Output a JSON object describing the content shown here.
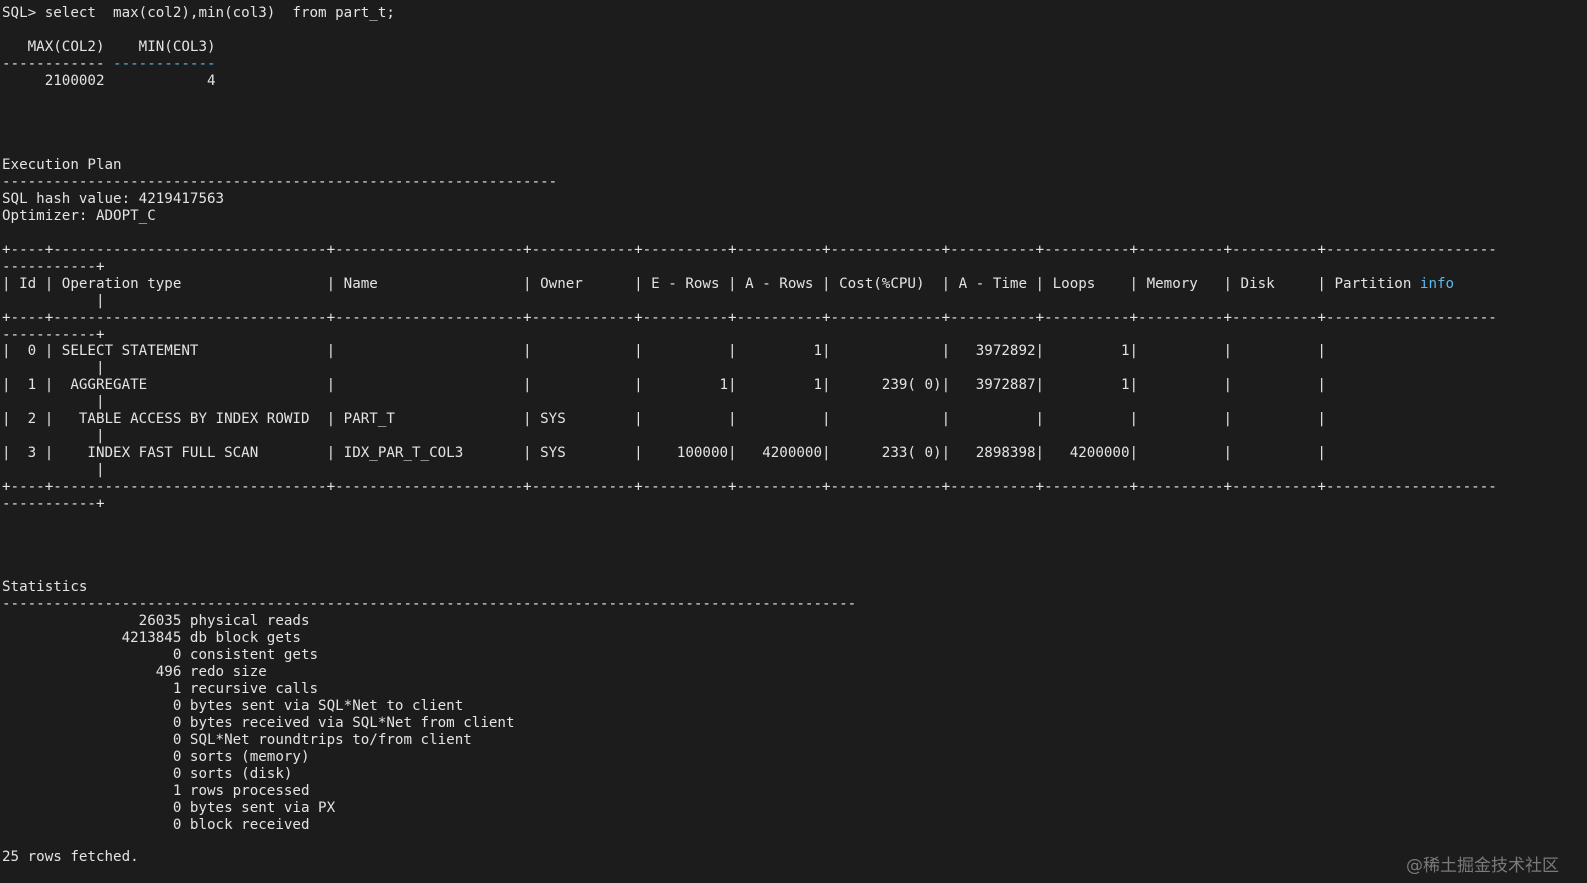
{
  "prompt_line": "SQL> select  max(col2),min(col3)  from part_t;",
  "result": {
    "header_line": "   MAX(COL2)    MIN(COL3)",
    "separator_left": "------------ ",
    "separator_right": "------------",
    "value_line": "     2100002            4"
  },
  "execution_plan": {
    "title": "Execution Plan",
    "rule": "-----------------------------------------------------------------",
    "hash_line": "SQL hash value: 4219417563",
    "optimizer_line": "Optimizer: ADOPT_C",
    "border_top": "+----+--------------------------------+----------------------+------------+----------+----------+-------------+----------+----------+----------+----------+--------------------",
    "border_top_wrap": "-----------+",
    "header_row": "| Id | Operation type                 | Name                 | Owner      | E - Rows | A - Rows | Cost(%CPU)  | A - Time | Loops    | Memory   | Disk     | Partition ",
    "header_highlight": "info",
    "header_wrap": "           |",
    "border_mid": "+----+--------------------------------+----------------------+------------+----------+----------+-------------+----------+----------+----------+----------+--------------------",
    "border_mid_wrap": "-----------+",
    "rows": [
      {
        "line": "|  0 | SELECT STATEMENT               |                      |            |          |         1|             |   3972892|         1|          |          |",
        "wrap": "           |"
      },
      {
        "line": "|  1 |  AGGREGATE                     |                      |            |         1|         1|      239( 0)|   3972887|         1|          |          |",
        "wrap": "           |"
      },
      {
        "line": "|  2 |   TABLE ACCESS BY INDEX ROWID  | PART_T               | SYS        |          |          |             |          |          |          |          |",
        "wrap": "           |"
      },
      {
        "line": "|  3 |    INDEX FAST FULL SCAN        | IDX_PAR_T_COL3       | SYS        |    100000|   4200000|      233( 0)|   2898398|   4200000|          |          |",
        "wrap": "           |"
      }
    ],
    "border_bottom": "+----+--------------------------------+----------------------+------------+----------+----------+-------------+----------+----------+----------+----------+--------------------",
    "border_bottom_wrap": "-----------+"
  },
  "statistics": {
    "title": "Statistics",
    "rule": "----------------------------------------------------------------------------------------------------",
    "items": [
      "                26035 physical reads",
      "              4213845 db block gets",
      "                    0 consistent gets",
      "                  496 redo size",
      "                    1 recursive calls",
      "                    0 bytes sent via SQL*Net to client",
      "                    0 bytes received via SQL*Net from client",
      "                    0 SQL*Net roundtrips to/from client",
      "                    0 sorts (memory)",
      "                    0 sorts (disk)",
      "                    1 rows processed",
      "                    0 bytes sent via PX",
      "                    0 block received"
    ]
  },
  "footer": "25 rows fetched.",
  "watermark": "@稀土掘金技术社区",
  "colors": {
    "background": "#1c1c1c",
    "text": "#e3e3e3",
    "highlight": "#5fb8e6",
    "watermark": "#7a7a7a"
  }
}
